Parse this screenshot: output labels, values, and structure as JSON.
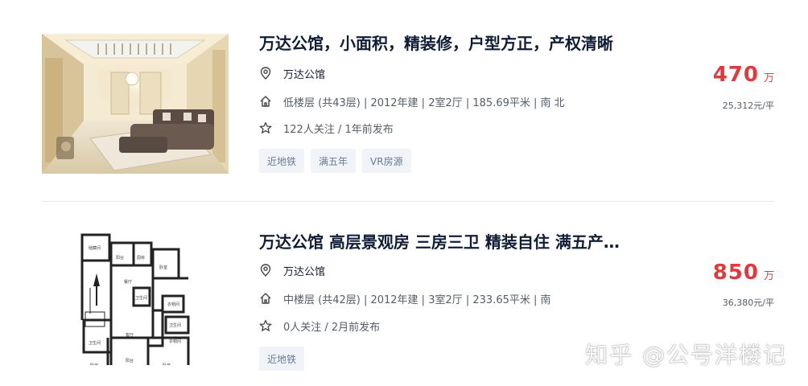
{
  "listings": [
    {
      "title": "万达公馆，小面积，精装修，户型方正，产权清晰",
      "community": "万达公馆",
      "info": "低楼层 (共43层) | 2012年建 | 2室2厅 | 185.69平米 | 南 北",
      "follow": "122人关注 / 1年前发布",
      "tags": [
        "近地铁",
        "满五年",
        "VR房源"
      ],
      "price": "470",
      "price_unit": "万",
      "unit_price": "25,312元/平",
      "image": "living-room-photo"
    },
    {
      "title": "万达公馆 高层景观房 三房三卫 精装自住 满五产…",
      "community": "万达公馆",
      "info": "中楼层 (共42层) | 2012年建 | 3室2厅 | 233.65平米 | 南",
      "follow": "0人关注 / 2月前发布",
      "tags": [
        "近地铁"
      ],
      "price": "850",
      "price_unit": "万",
      "unit_price": "36,380元/平",
      "image": "floor-plan"
    }
  ],
  "icons": {
    "community": "location-pin-icon",
    "info": "house-icon",
    "follow": "star-icon"
  },
  "colors": {
    "title": "#101d37",
    "price": "#e4393c",
    "tag_bg": "#f0f4f8",
    "tag_text": "#6b7b8f"
  },
  "watermark": "知乎 @公号洋楼记"
}
